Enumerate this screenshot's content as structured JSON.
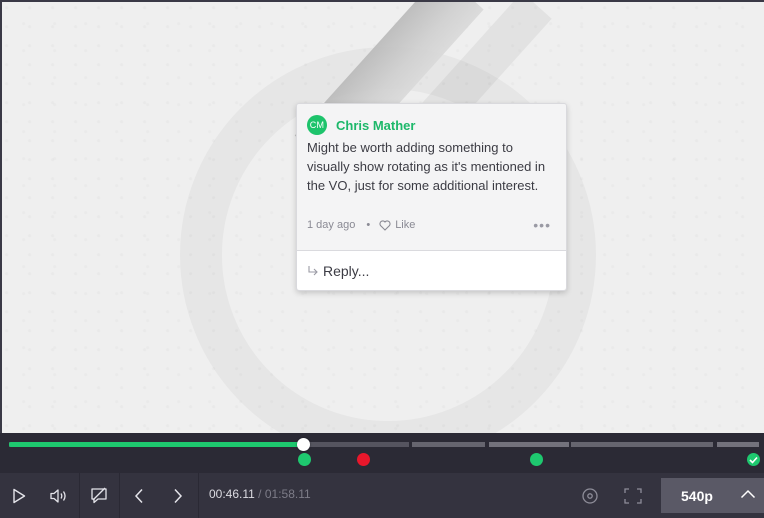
{
  "comment": {
    "avatar_initials": "CM",
    "author": "Chris Mather",
    "text": "Might be worth adding something to visually show rotating as it's mentioned in the VO, just for some additional interest.",
    "timestamp": "1 day ago",
    "separator": "•",
    "like_label": "Like",
    "more_label": "•••",
    "reply_placeholder": "Reply..."
  },
  "player": {
    "current_time": "00:46.11",
    "total_time": "/ 01:58.11",
    "quality": "540p",
    "progress_fraction": 0.393,
    "markers": [
      {
        "kind": "comment",
        "color": "#1ec86f"
      },
      {
        "kind": "comment",
        "color": "#e8172b"
      },
      {
        "kind": "comment",
        "color": "#1ec86f"
      },
      {
        "kind": "completed",
        "color": "#1ec86f"
      }
    ]
  },
  "colors": {
    "accent_green": "#1ec86f",
    "marker_red": "#e8172b",
    "control_bar": "#34333f"
  },
  "icons": [
    "play-icon",
    "volume-icon",
    "comment-toggle-icon",
    "prev-icon",
    "next-icon",
    "target-icon",
    "fullscreen-icon",
    "chevron-up-icon",
    "heart-icon",
    "reply-arrow-icon"
  ]
}
